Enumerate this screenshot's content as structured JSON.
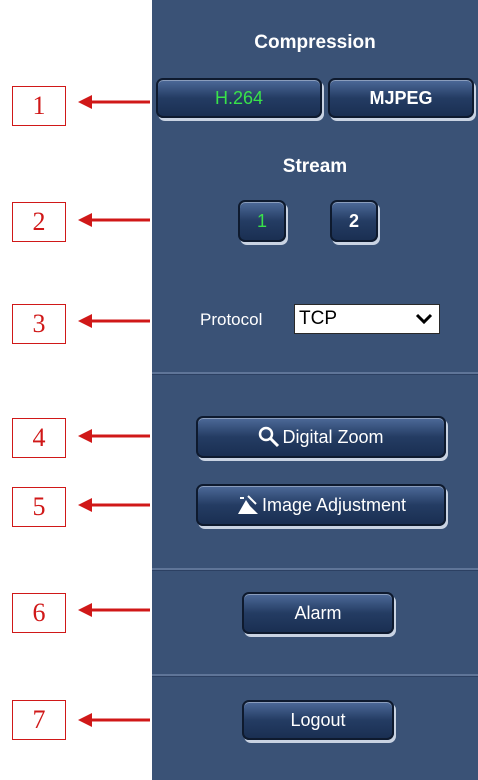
{
  "callouts": [
    "1",
    "2",
    "3",
    "4",
    "5",
    "6",
    "7"
  ],
  "compression": {
    "heading": "Compression",
    "h264_label": "H.264",
    "mjpeg_label": "MJPEG"
  },
  "stream": {
    "heading": "Stream",
    "stream1_label": "1",
    "stream2_label": "2"
  },
  "protocol": {
    "label": "Protocol",
    "selected": "TCP"
  },
  "buttons": {
    "digital_zoom": "Digital Zoom",
    "image_adjustment": "Image Adjustment",
    "alarm": "Alarm",
    "logout": "Logout"
  },
  "colors": {
    "panel": "#3a5276",
    "callout": "#d01818",
    "active_text": "#39e24a"
  }
}
